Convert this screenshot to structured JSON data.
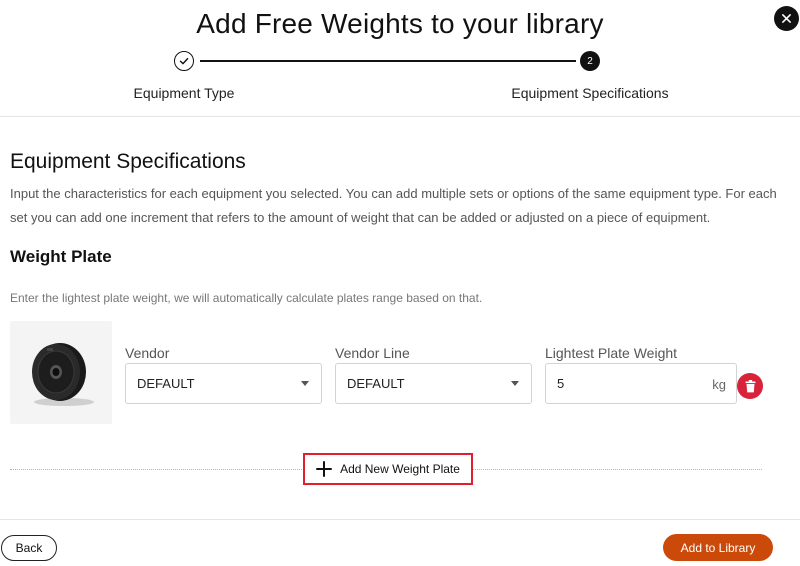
{
  "modal": {
    "title": "Add Free Weights to your library"
  },
  "stepper": {
    "steps": [
      {
        "label": "Equipment Type",
        "state": "completed"
      },
      {
        "label": "Equipment Specifications",
        "number": "2",
        "state": "active"
      }
    ]
  },
  "specs": {
    "title": "Equipment Specifications",
    "description": "Input the characteristics for each equipment you selected. You can add multiple sets or options of the same equipment type. For each set you can add one increment that refers to the amount of weight that can be added or adjusted on a piece of equipment.",
    "group": {
      "title": "Weight Plate",
      "hint": "Enter the lightest plate weight, we will automatically calculate plates range based on that.",
      "row": {
        "vendor_label": "Vendor",
        "vendor_value": "DEFAULT",
        "vendor_line_label": "Vendor Line",
        "vendor_line_value": "DEFAULT",
        "weight_label": "Lightest Plate Weight",
        "weight_value": "5",
        "weight_unit": "kg"
      }
    },
    "add_button_label": "Add New Weight Plate"
  },
  "footer": {
    "back_label": "Back",
    "submit_label": "Add to Library"
  },
  "colors": {
    "primary_action": "#cc4a09",
    "delete": "#d9233b",
    "highlight_border": "#e0202e"
  },
  "icons": {
    "close": "close-icon",
    "check": "check-icon",
    "trash": "trash-icon",
    "plus": "plus-icon",
    "chevron": "chevron-down-icon"
  }
}
